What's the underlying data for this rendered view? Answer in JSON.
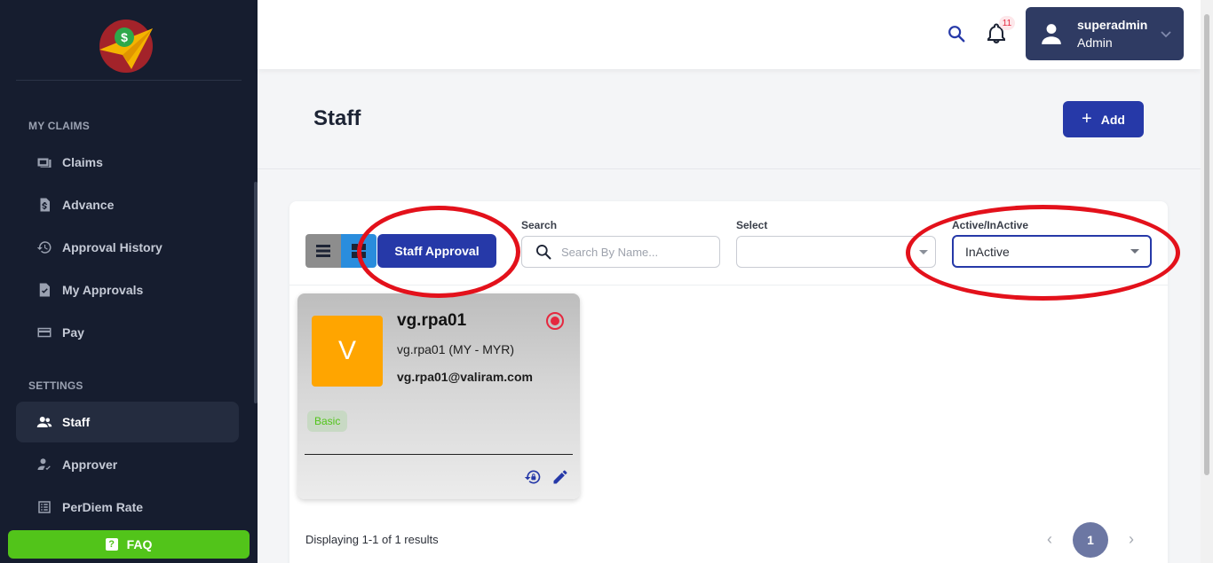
{
  "sidebar": {
    "sections": [
      {
        "title": "MY CLAIMS",
        "items": [
          {
            "label": "Claims",
            "icon": "claims-icon"
          },
          {
            "label": "Advance",
            "icon": "advance-icon"
          },
          {
            "label": "Approval History",
            "icon": "history-icon"
          },
          {
            "label": "My Approvals",
            "icon": "approvals-icon"
          },
          {
            "label": "Pay",
            "icon": "card-icon"
          }
        ]
      },
      {
        "title": "SETTINGS",
        "items": [
          {
            "label": "Staff",
            "icon": "users-icon",
            "active": true
          },
          {
            "label": "Approver",
            "icon": "approver-icon"
          },
          {
            "label": "PerDiem Rate",
            "icon": "list-icon"
          }
        ]
      }
    ],
    "faq_label": "FAQ"
  },
  "topbar": {
    "notification_count": "11",
    "user": {
      "name": "superadmin",
      "role": "Admin"
    }
  },
  "page": {
    "title": "Staff",
    "add_label": "Add"
  },
  "filters": {
    "staff_approval_label": "Staff Approval",
    "search_label": "Search",
    "search_placeholder": "Search By Name...",
    "select_label": "Select",
    "select_value": "",
    "status_label": "Active/InActive",
    "status_value": "InActive"
  },
  "staff_cards": [
    {
      "initial": "V",
      "username": "vg.rpa01",
      "subtitle": "vg.rpa01 (MY - MYR)",
      "email": "vg.rpa01@valiram.com",
      "tier": "Basic"
    }
  ],
  "pagination": {
    "results_text": "Displaying 1-1 of 1 results",
    "current_page": "1"
  },
  "colors": {
    "sidebar_bg": "#161d2f",
    "primary": "#2639a8",
    "faq_green": "#52c41a",
    "avatar_orange": "#ffa500",
    "annotation_red": "#e3111b"
  }
}
